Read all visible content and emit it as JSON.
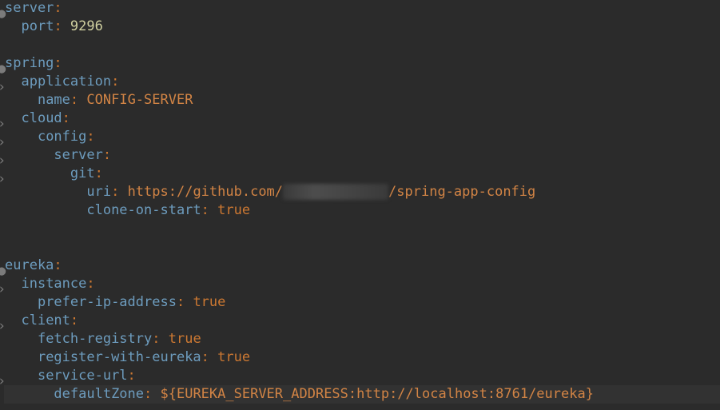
{
  "lines": [
    {
      "indent": "",
      "key": "server",
      "value": ""
    },
    {
      "indent": "  ",
      "key": "port",
      "value": "9296"
    },
    {
      "indent": "",
      "key": "spring",
      "value": ""
    },
    {
      "indent": "  ",
      "key": "application",
      "value": ""
    },
    {
      "indent": "    ",
      "key": "name",
      "value": "CONFIG-SERVER"
    },
    {
      "indent": "  ",
      "key": "cloud",
      "value": ""
    },
    {
      "indent": "    ",
      "key": "config",
      "value": ""
    },
    {
      "indent": "      ",
      "key": "server",
      "value": ""
    },
    {
      "indent": "        ",
      "key": "git",
      "value": ""
    },
    {
      "indent": "          ",
      "key": "uri",
      "value_prefix": "https://github.com/",
      "value_suffix": "/spring-app-config"
    },
    {
      "indent": "          ",
      "key": "clone-on-start",
      "value": "true"
    },
    {
      "indent": "",
      "key": "eureka",
      "value": ""
    },
    {
      "indent": "  ",
      "key": "instance",
      "value": ""
    },
    {
      "indent": "    ",
      "key": "prefer-ip-address",
      "value": "true"
    },
    {
      "indent": "  ",
      "key": "client",
      "value": ""
    },
    {
      "indent": "    ",
      "key": "fetch-registry",
      "value": "true"
    },
    {
      "indent": "    ",
      "key": "register-with-eureka",
      "value": "true"
    },
    {
      "indent": "    ",
      "key": "service-url",
      "value": ""
    },
    {
      "indent": "      ",
      "key": "defaultZone",
      "value": "${EUREKA_SERVER_ADDRESS:http://localhost:8761/eureka}"
    }
  ],
  "colors": {
    "background": "#2b2b2b",
    "current_line": "#323232",
    "key": "#6d9cbe",
    "colon": "#cc7832",
    "string": "#d28445"
  }
}
